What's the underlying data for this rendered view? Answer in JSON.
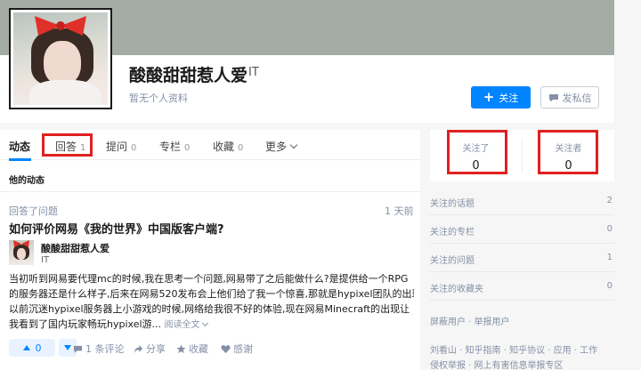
{
  "profile": {
    "name": "酸酸甜甜惹人爱",
    "industry": "IT",
    "bio_placeholder": "暂无个人资料",
    "follow_label": "关注",
    "message_label": "发私信"
  },
  "tabs": [
    {
      "label": "动态",
      "count": ""
    },
    {
      "label": "回答",
      "count": "1"
    },
    {
      "label": "提问",
      "count": "0"
    },
    {
      "label": "专栏",
      "count": "0"
    },
    {
      "label": "收藏",
      "count": "0"
    },
    {
      "label": "更多",
      "count": ""
    }
  ],
  "feed": {
    "section_title": "他的动态",
    "meta": "回答了问题",
    "time": "1 天前",
    "question_title": "如何评价网易《我的世界》中国版客户端?",
    "author": {
      "name": "酸酸甜甜惹人爱",
      "industry": "IT"
    },
    "excerpt_lines": [
      "当初听到网易要代理mc的时候,我在思考一个问题,网易带了之后能做什么?是提供给一个RPG",
      "的服务器还是什么样子,后来在网易520发布会上他们给了我一个惊喜,那就是hypixel团队的出现。",
      "以前沉迷hypixel服务器上小游戏的时候,网络给我很不好的体验,现在网易Minecraft的出现让",
      "我看到了国内玩家畅玩hypixel游..."
    ],
    "read_more": "阅读全文",
    "vote_count": "0",
    "actions": {
      "comments": "1 条评论",
      "share": "分享",
      "collect": "收藏",
      "thanks": "感谢"
    }
  },
  "sidebar": {
    "following_label": "关注了",
    "following_count": "0",
    "followers_label": "关注者",
    "followers_count": "0",
    "stats": [
      {
        "label": "关注的话题",
        "value": "2"
      },
      {
        "label": "关注的专栏",
        "value": "0"
      },
      {
        "label": "关注的问题",
        "value": "1"
      },
      {
        "label": "关注的收藏夹",
        "value": "0"
      }
    ],
    "links": "屏蔽用户 · 举报用户",
    "footer_line1": "刘看山 · 知乎指南 · 知乎协议 · 应用 · 工作",
    "footer_line2": "侵权举报 · 网上有害信息举报专区"
  },
  "colors": {
    "accent": "#0084ff",
    "highlight_box": "#e02020",
    "cover": "#a5aca5"
  }
}
